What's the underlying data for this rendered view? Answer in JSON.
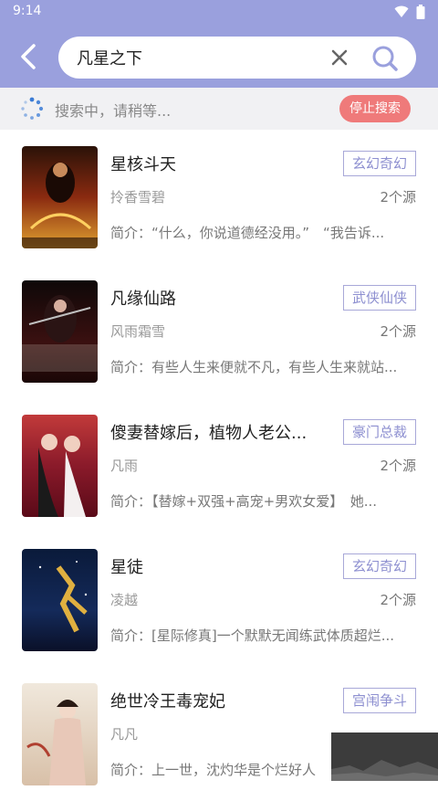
{
  "status": {
    "time": "9:14",
    "wifi_icon": "wifi-icon",
    "battery_icon": "battery-icon"
  },
  "header": {
    "back_icon": "chevron-left-icon",
    "search": {
      "value": "凡星之下",
      "placeholder": ""
    },
    "clear_icon": "close-icon",
    "search_icon": "search-icon",
    "color": "#9aa0dd"
  },
  "progress": {
    "text": "搜索中，请稍等...",
    "stop_label": "停止搜索",
    "stop_color": "#ef7a7a"
  },
  "books": [
    {
      "title": "星核斗天",
      "tag": "玄幻奇幻",
      "author": "拎香雪碧",
      "sources": "2个源",
      "intro": "简介：“什么，你说道德经没用。”　“我告诉..."
    },
    {
      "title": "凡缘仙路",
      "tag": "武侠仙侠",
      "author": "风雨霜雪",
      "sources": "2个源",
      "intro": "简介：有些人生来便就不凡，有些人生来就站..."
    },
    {
      "title": "傻妻替嫁后，植物人老公...",
      "tag": "豪门总裁",
      "author": "凡雨",
      "sources": "2个源",
      "intro": "简介：【替嫁+双强+高宠+男欢女爱】　她..."
    },
    {
      "title": "星徒",
      "tag": "玄幻奇幻",
      "author": "凌越",
      "sources": "2个源",
      "intro": "简介：[星际修真]一个默默无闻练武体质超烂..."
    },
    {
      "title": "绝世冷王毒宠妃",
      "tag": "宫闱争斗",
      "author": "凡凡",
      "sources": "",
      "intro": "简介：上一世，沈灼华是个烂好人"
    }
  ]
}
